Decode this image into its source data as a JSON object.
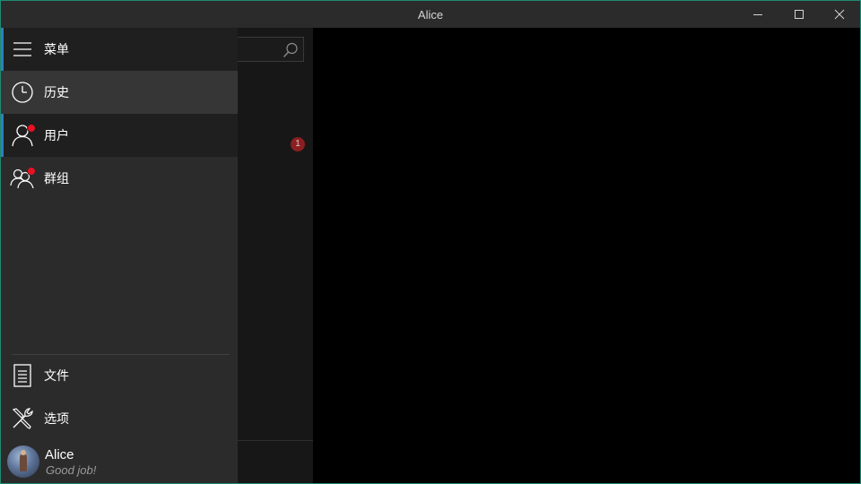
{
  "window": {
    "title": "Alice",
    "border_color": "#1f8a70"
  },
  "search": {
    "icon": "search-icon"
  },
  "conversation_badge": {
    "count": "1",
    "color": "#8a1f22"
  },
  "nav": {
    "accent_color": "#2d7fbf",
    "items": [
      {
        "label": "菜单",
        "icon": "hamburger-icon",
        "selected": false
      },
      {
        "label": "历史",
        "icon": "clock-icon",
        "selected": false
      },
      {
        "label": "用户",
        "icon": "user-icon",
        "selected": true,
        "notification_dot": true
      },
      {
        "label": "群组",
        "icon": "group-icon",
        "selected": false,
        "notification_dot": true
      }
    ],
    "footer_items": [
      {
        "label": "文件",
        "icon": "document-icon"
      },
      {
        "label": "选项",
        "icon": "tools-icon"
      }
    ]
  },
  "profile": {
    "name": "Alice",
    "status": "Good job!"
  }
}
